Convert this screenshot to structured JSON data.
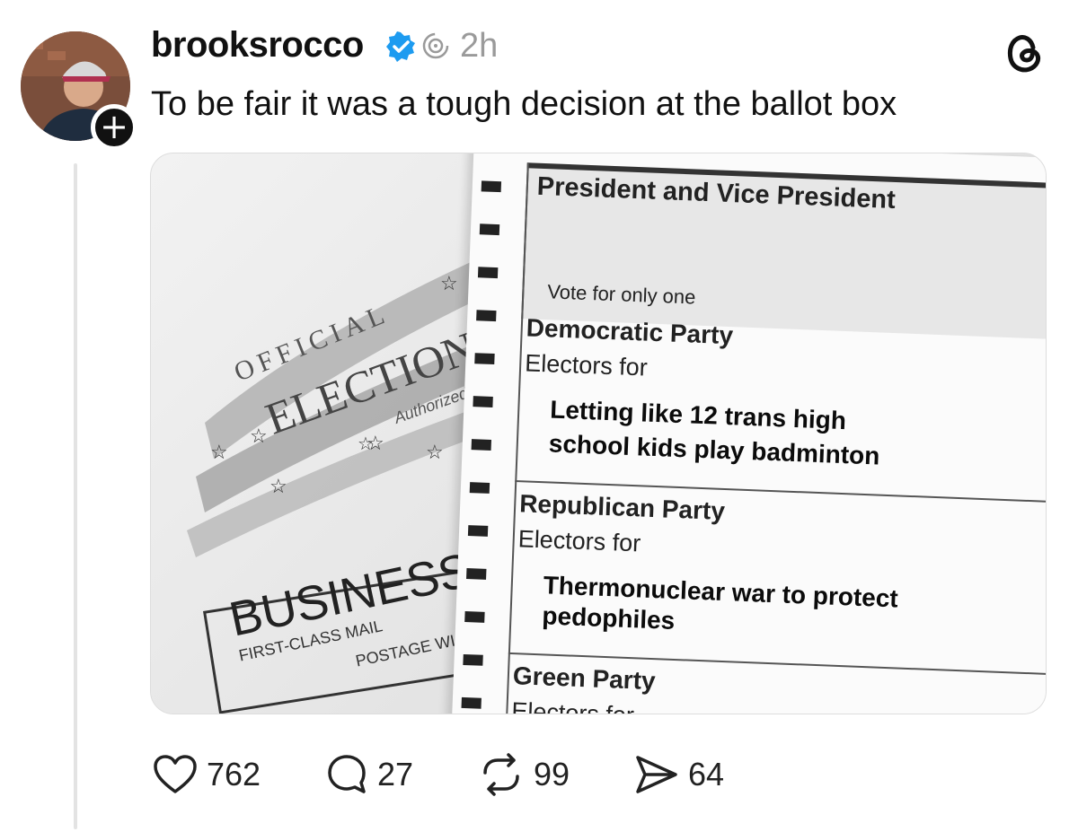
{
  "post": {
    "username": "brooksrocco",
    "timestamp": "2h",
    "text": "To be fair it was a tough decision at the ballot box",
    "verified_color": "#1d9bf0"
  },
  "ballot": {
    "header": "President and Vice President",
    "instruction": "Vote for only one",
    "options": [
      {
        "party": "Democratic Party",
        "electors": "Electors for",
        "choice_line1": "Letting like 12 trans high",
        "choice_line2": "school kids play badminton"
      },
      {
        "party": "Republican Party",
        "electors": "Electors for",
        "choice_line1": "Thermonuclear war to protect",
        "choice_line2": "pedophiles"
      },
      {
        "party": "Green Party",
        "electors": "Electors for"
      }
    ]
  },
  "envelope": {
    "official": "OFFICIAL",
    "election": "ELECTION",
    "authorized": "Authorized by",
    "business": "BUSINESS",
    "first_class": "FIRST-CLASS MAIL",
    "postage": "POSTAGE WI"
  },
  "actions": {
    "likes": "762",
    "replies": "27",
    "reposts": "99",
    "shares": "64"
  }
}
